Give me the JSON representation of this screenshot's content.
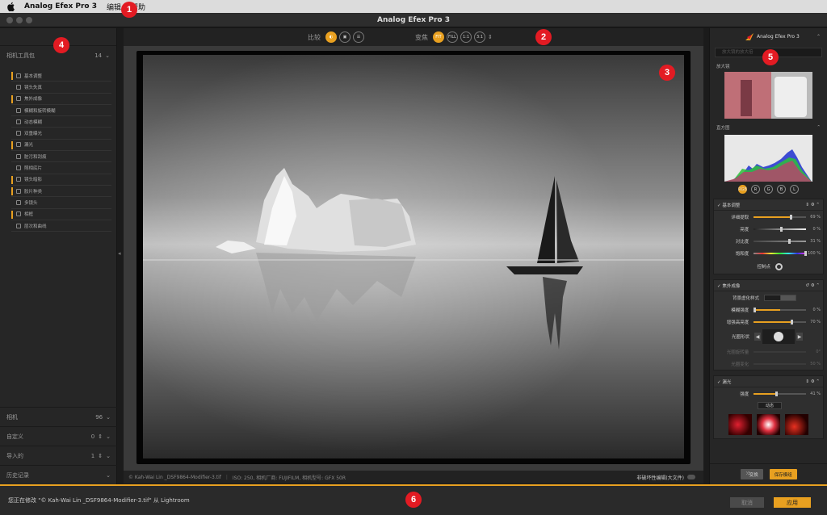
{
  "menubar": {
    "app": "Analog Efex Pro 3",
    "items": [
      "编辑",
      "帮助"
    ]
  },
  "window": {
    "title": "Analog Efex Pro 3"
  },
  "badges": [
    "1",
    "2",
    "3",
    "4",
    "5",
    "6"
  ],
  "toolbar": {
    "compare_label": "比较",
    "zoom_label": "变焦",
    "zoom_buttons": [
      "FIT",
      "FILL",
      "1:1",
      "3:1"
    ],
    "active_zoom": "FIT"
  },
  "left_panel": {
    "camera_kit": {
      "title": "相机工具包",
      "count": "14"
    },
    "tools": [
      {
        "label": "基本调整",
        "active": true
      },
      {
        "label": "镜头失真",
        "active": false
      },
      {
        "label": "焦外成像",
        "active": true
      },
      {
        "label": "模糊和旋转模糊",
        "active": false
      },
      {
        "label": "动态模糊",
        "active": false
      },
      {
        "label": "双重曝光",
        "active": false
      },
      {
        "label": "漏光",
        "active": true
      },
      {
        "label": "脏污和刮痕",
        "active": false
      },
      {
        "label": "照相底片",
        "active": false
      },
      {
        "label": "镜头暗影",
        "active": true
      },
      {
        "label": "胶片种类",
        "active": true
      },
      {
        "label": "多镜头",
        "active": false
      },
      {
        "label": "相框",
        "active": true
      },
      {
        "label": "层次和曲线",
        "active": false
      }
    ],
    "sections": [
      {
        "label": "相机",
        "count": "96"
      },
      {
        "label": "自定义",
        "count": "0"
      },
      {
        "label": "导入的",
        "count": "1"
      },
      {
        "label": "历史记录",
        "count": ""
      }
    ]
  },
  "status": {
    "copyright": "© Kah-Wai Lin _DSF9864-Modifier-3.tif",
    "meta": "ISO: 250, 相机厂商: FUJIFILM, 相机型号: GFX 50R",
    "toggle_label": "非破坏性编辑(大文件)"
  },
  "right_panel": {
    "brand": "Analog Efex Pro 3",
    "search_placeholder": "放大镜的放大倍",
    "loupe_label": "放大镜",
    "histogram_label": "直方图",
    "channels": [
      "RGB",
      "R",
      "G",
      "B",
      "L"
    ],
    "basic": {
      "title": "基本调整",
      "sliders": [
        {
          "label": "详细提取",
          "value": "69 %",
          "pct": 0.69,
          "type": "fill"
        },
        {
          "label": "亮度",
          "value": "0 %",
          "pct": 0.5,
          "type": "gray"
        },
        {
          "label": "对比度",
          "value": "31 %",
          "pct": 0.66,
          "type": "dark"
        },
        {
          "label": "饱和度",
          "value": "100 %",
          "pct": 1.0,
          "type": "rainbow"
        }
      ],
      "control_point_label": "控制点"
    },
    "bokeh": {
      "title": "焦外成像",
      "style_label": "背景虚化样式",
      "sliders": [
        {
          "label": "模糊强度",
          "value": "0 %",
          "pct": 0.0
        },
        {
          "label": "增强高亮度",
          "value": "70 %",
          "pct": 0.7
        }
      ],
      "shape_label": "光圈形状",
      "rotation_label": "光圈旋转量",
      "rotation_value": "0°",
      "variation_label": "光圈变化",
      "variation_value": "50 %"
    },
    "leak": {
      "title": "漏光",
      "strength_label": "强度",
      "strength_value": "41 %",
      "mode": "动态"
    },
    "footer": {
      "random_label": "变换",
      "save_label": "保存模组"
    }
  },
  "bottom": {
    "message": "您正在修改 \"© Kah-Wai Lin _DSF9864-Modifier-3.tif\" 从 Lightroom",
    "cancel": "取消",
    "apply": "应用"
  },
  "colors": {
    "accent": "#e8a020",
    "badge": "#e31b23"
  }
}
